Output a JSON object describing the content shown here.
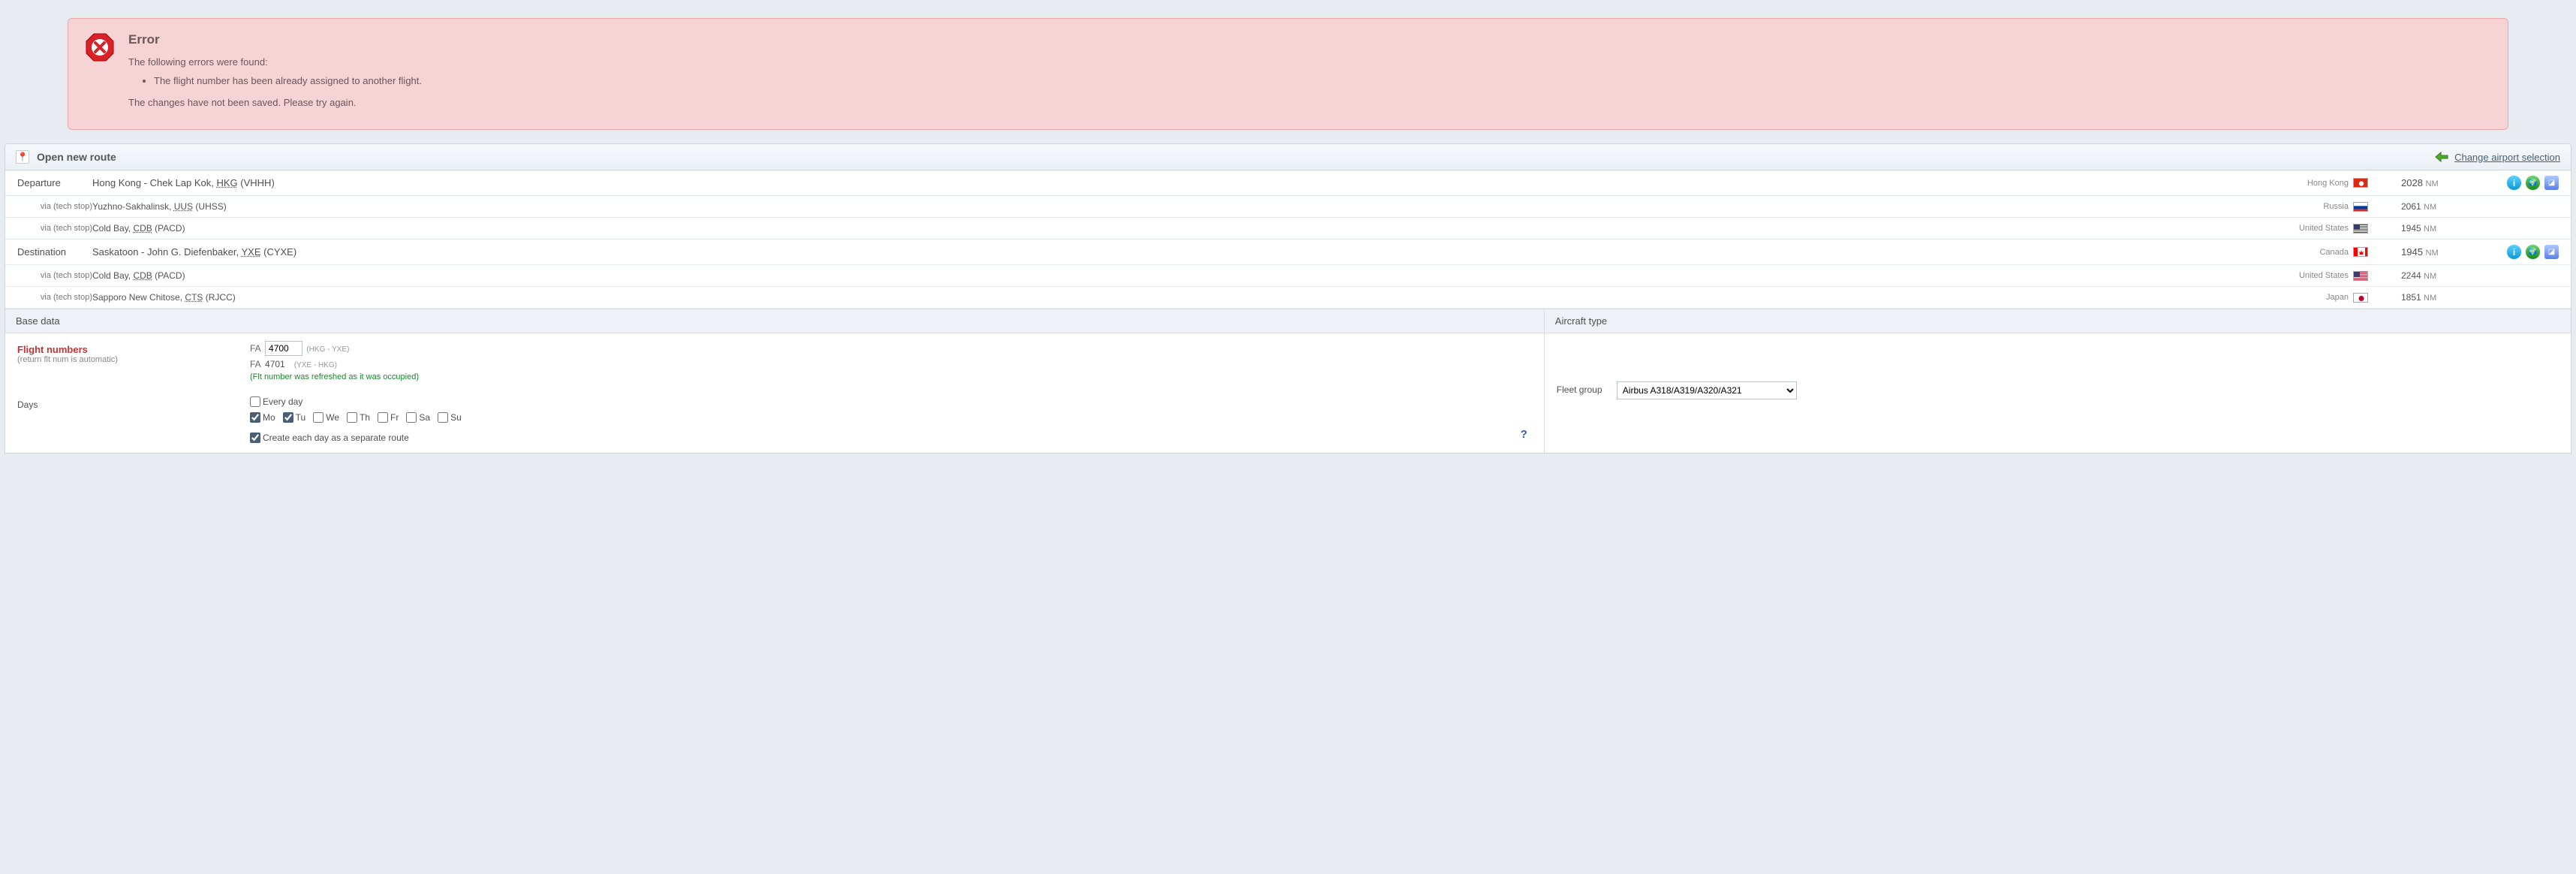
{
  "error": {
    "title": "Error",
    "intro": "The following errors were found:",
    "items": [
      "The flight number has been already assigned to another flight."
    ],
    "outro": "The changes have not been saved. Please try again."
  },
  "panel": {
    "title": "Open new route",
    "change_airport": "Change airport selection"
  },
  "routes": [
    {
      "label": "Departure",
      "sub": false,
      "city": "Hong Kong - Chek Lap Kok, ",
      "code": "HKG",
      "extra": " (VHHH)",
      "country": "Hong Kong",
      "flag": "hk",
      "dist": "2028",
      "icons": true
    },
    {
      "label": "via (tech stop)",
      "sub": true,
      "city": "Yuzhno-Sakhalinsk, ",
      "code": "UUS",
      "extra": " (UHSS)",
      "country": "Russia",
      "flag": "ru",
      "dist": "2061",
      "icons": false
    },
    {
      "label": "via (tech stop)",
      "sub": true,
      "city": "Cold Bay, ",
      "code": "CDB",
      "extra": " (PACD)",
      "country": "United States",
      "flag": "us",
      "dist": "1945",
      "icons": false
    },
    {
      "label": "Destination",
      "sub": false,
      "city": "Saskatoon - John G. Diefenbaker, ",
      "code": "YXE",
      "extra": " (CYXE)",
      "country": "Canada",
      "flag": "ca",
      "dist": "1945",
      "icons": true
    },
    {
      "label": "via (tech stop)",
      "sub": true,
      "city": "Cold Bay, ",
      "code": "CDB",
      "extra": " (PACD)",
      "country": "United States",
      "flag": "us",
      "dist": "2244",
      "icons": false
    },
    {
      "label": "via (tech stop)",
      "sub": true,
      "city": "Sapporo New Chitose, ",
      "code": "CTS",
      "extra": " (RJCC)",
      "country": "Japan",
      "flag": "jp",
      "dist": "1851",
      "icons": false
    }
  ],
  "nm_label": "NM",
  "sections": {
    "base_data": "Base data",
    "aircraft_type": "Aircraft type"
  },
  "flight_numbers": {
    "label": "Flight numbers",
    "hint": "(return flt num is automatic)",
    "prefix": "FA",
    "out_value": "4700",
    "out_route": "(HKG - YXE)",
    "ret_value": "4701",
    "ret_route": "(YXE - HKG)",
    "refreshed": "(Flt number was refreshed as it was occupied)"
  },
  "days": {
    "label": "Days",
    "every": "Every day",
    "list": [
      {
        "short": "Mo",
        "checked": true
      },
      {
        "short": "Tu",
        "checked": true
      },
      {
        "short": "We",
        "checked": false
      },
      {
        "short": "Th",
        "checked": false
      },
      {
        "short": "Fr",
        "checked": false
      },
      {
        "short": "Sa",
        "checked": false
      },
      {
        "short": "Su",
        "checked": false
      }
    ],
    "separate": "Create each day as a separate route",
    "separate_checked": true
  },
  "fleet": {
    "label": "Fleet group",
    "selected": "Airbus A318/A319/A320/A321"
  }
}
